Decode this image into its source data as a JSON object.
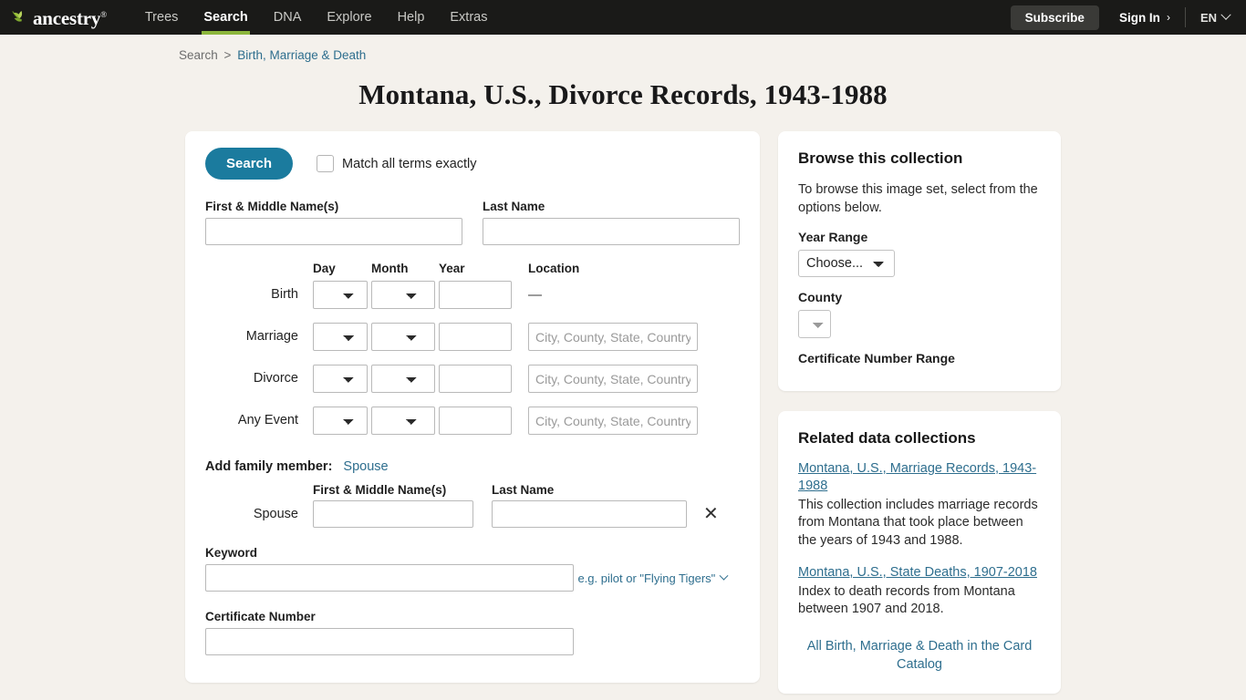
{
  "topnav": {
    "logo_text": "ancestry",
    "logo_tm": "®",
    "items": [
      {
        "label": "Trees",
        "active": false
      },
      {
        "label": "Search",
        "active": true
      },
      {
        "label": "DNA",
        "active": false
      },
      {
        "label": "Explore",
        "active": false
      },
      {
        "label": "Help",
        "active": false
      },
      {
        "label": "Extras",
        "active": false
      }
    ],
    "subscribe_label": "Subscribe",
    "signin_label": "Sign In",
    "signin_chevron": "›",
    "language_label": "EN",
    "accent_green": "#8cb63c",
    "bar_background": "#1a1a18"
  },
  "breadcrumb": {
    "root": "Search",
    "separator": ">",
    "current": "Birth, Marriage & Death"
  },
  "page": {
    "title": "Montana, U.S., Divorce Records, 1943-1988",
    "background": "#f4f1ec"
  },
  "search_form": {
    "search_button": "Search",
    "exact_checkbox_label": "Match all terms exactly",
    "exact_checked": false,
    "accent_teal": "#1b7b9e",
    "first_name": {
      "label": "First & Middle Name(s)",
      "value": "",
      "placeholder": ""
    },
    "last_name": {
      "label": "Last Name",
      "value": "",
      "placeholder": ""
    },
    "event_headers": {
      "day": "Day",
      "month": "Month",
      "year": "Year",
      "location": "Location"
    },
    "events": [
      {
        "label": "Birth",
        "day": "",
        "month": "",
        "year": "",
        "location_placeholder": "",
        "location_value": "",
        "location_disabled": true,
        "location_dash": "—"
      },
      {
        "label": "Marriage",
        "day": "",
        "month": "",
        "year": "",
        "location_placeholder": "City, County, State, Country",
        "location_value": "",
        "location_disabled": false,
        "location_dash": ""
      },
      {
        "label": "Divorce",
        "day": "",
        "month": "",
        "year": "",
        "location_placeholder": "City, County, State, Country",
        "location_value": "",
        "location_disabled": false,
        "location_dash": ""
      },
      {
        "label": "Any Event",
        "day": "",
        "month": "",
        "year": "",
        "location_placeholder": "City, County, State, Country",
        "location_value": "",
        "location_disabled": false,
        "location_dash": ""
      }
    ],
    "family": {
      "add_label": "Add family member:",
      "add_link": "Spouse",
      "col_first": "First & Middle Name(s)",
      "col_last": "Last Name",
      "row_label": "Spouse",
      "first_value": "",
      "last_value": "",
      "remove_glyph": "✕"
    },
    "keyword": {
      "label": "Keyword",
      "value": "",
      "hint": "e.g. pilot or \"Flying Tigers\""
    },
    "certificate": {
      "label": "Certificate Number",
      "value": ""
    }
  },
  "browse_panel": {
    "title": "Browse this collection",
    "description": "To browse this image set, select from the options below.",
    "year_range_label": "Year Range",
    "year_range_value": "Choose...",
    "county_label": "County",
    "county_value": "",
    "certificate_range_label": "Certificate Number Range"
  },
  "related_panel": {
    "title": "Related data collections",
    "items": [
      {
        "link": "Montana, U.S., Marriage Records, 1943-1988",
        "description": "This collection includes marriage records from Montana that took place between the years of 1943 and 1988."
      },
      {
        "link": "Montana, U.S., State Deaths, 1907-2018",
        "description": "Index to death records from Montana between 1907 and 2018."
      }
    ],
    "catalog_link": "All Birth, Marriage & Death in the Card Catalog"
  }
}
